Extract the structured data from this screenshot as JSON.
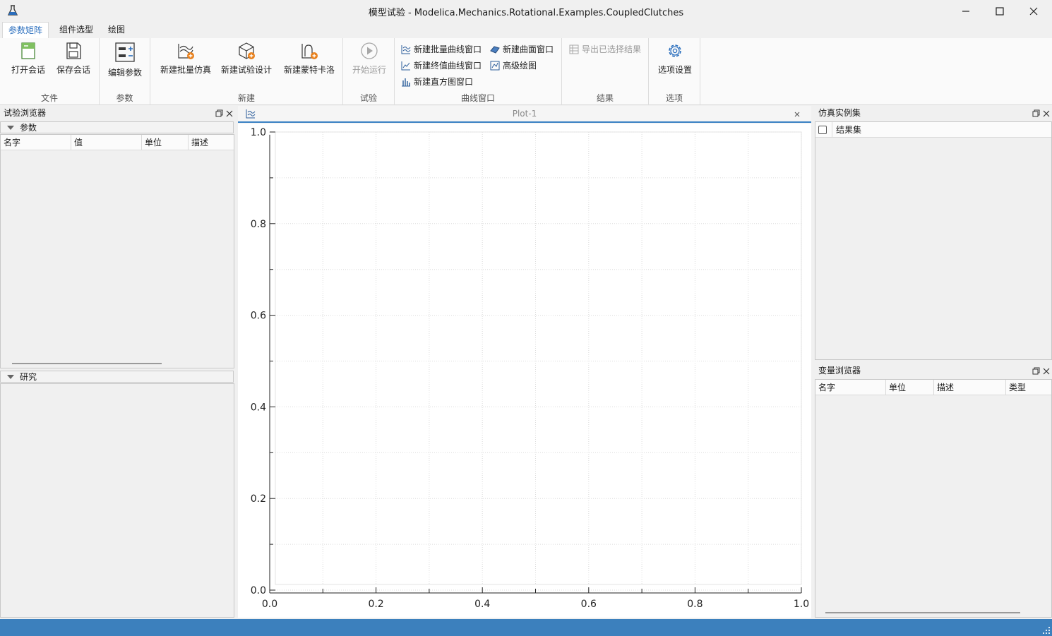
{
  "window": {
    "title": "模型试验 - Modelica.Mechanics.Rotational.Examples.CoupledClutches"
  },
  "menu": {
    "tabs": [
      {
        "label": "参数矩阵"
      },
      {
        "label": "组件选型"
      },
      {
        "label": "绘图"
      }
    ]
  },
  "ribbon": {
    "groups": {
      "file": "文件",
      "params": "参数",
      "new": "新建",
      "experiment": "试验",
      "curve_window": "曲线窗口",
      "result": "结果",
      "options": "选项"
    },
    "buttons": {
      "open_session": "打开会话",
      "save_session": "保存会话",
      "edit_params": "编辑参数",
      "new_batch_sim": "新建批量仿真",
      "new_experiment_design": "新建试验设计",
      "new_monte_carlo": "新建蒙特卡洛",
      "start_run": "开始运行",
      "new_batch_curve_window": "新建批量曲线窗口",
      "new_surface_window": "新建曲面窗口",
      "new_final_value_curve_window": "新建终值曲线窗口",
      "advanced_plot": "高级绘图",
      "new_histogram_window": "新建直方图窗口",
      "export_selected_results": "导出已选择结果",
      "option_settings": "选项设置"
    }
  },
  "left_panel": {
    "title": "试验浏览器",
    "params_section": "参数",
    "columns": [
      "名字",
      "值",
      "单位",
      "描述"
    ],
    "study_section": "研究"
  },
  "plot": {
    "tab_title": "Plot-1",
    "x_ticks": [
      "0.0",
      "0.2",
      "0.4",
      "0.6",
      "0.8",
      "1.0"
    ],
    "y_ticks": [
      "0.0",
      "0.2",
      "0.4",
      "0.6",
      "0.8",
      "1.0"
    ]
  },
  "chart_data": {
    "type": "line",
    "series": [],
    "xlim": [
      0,
      1
    ],
    "ylim": [
      0,
      1
    ],
    "xticks": [
      "0.0",
      "0.2",
      "0.4",
      "0.6",
      "0.8",
      "1.0"
    ],
    "yticks": [
      "0.0",
      "0.2",
      "0.4",
      "0.6",
      "0.8",
      "1.0"
    ],
    "grid": true
  },
  "right_top_panel": {
    "title": "仿真实例集",
    "column": "结果集"
  },
  "right_bottom_panel": {
    "title": "变量浏览器",
    "columns": [
      "名字",
      "单位",
      "描述",
      "类型"
    ]
  },
  "colors": {
    "accent": "#2a6ebd",
    "statusbar": "#3c80bd",
    "orange_badge": "#e8801c"
  }
}
